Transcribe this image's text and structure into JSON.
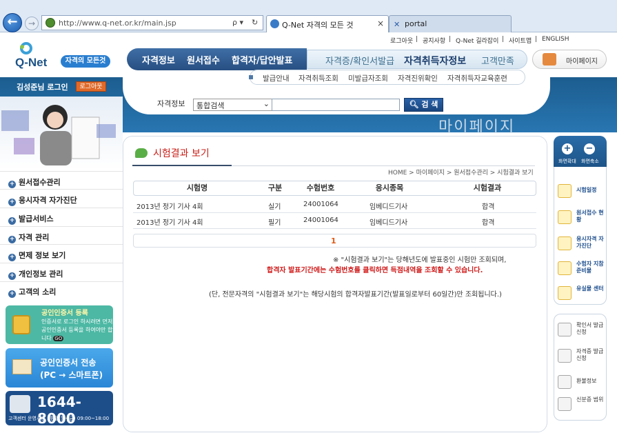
{
  "browser": {
    "url": "http://www.q-net.or.kr/main.jsp",
    "search_glyph": "ρ ▾",
    "refresh_glyph": "↻",
    "tabs": [
      {
        "label": "Q-Net 자격의 모든 것",
        "close": "×"
      },
      {
        "label": "portal"
      }
    ]
  },
  "utility_links": [
    "로그아웃",
    "|",
    "공지사항",
    "|",
    "Q-Net 길라잡이",
    "|",
    "사이트맵",
    "|",
    "ENGLISH"
  ],
  "logo": {
    "text": "Q-Net",
    "badge": "자격의 모든것"
  },
  "main_nav": {
    "left": [
      "자격정보",
      "원서접수",
      "합격자/답안발표"
    ],
    "right": [
      "자격증/확인서발급",
      "자격취득자정보",
      "고객만족"
    ],
    "mypage": "마이페이지"
  },
  "sub_nav": [
    "발급안내",
    "자격취득조회",
    "미발급자조회",
    "자격진위확인",
    "자격취득자교육훈련"
  ],
  "search": {
    "label": "자격정보",
    "select_value": "통합검색",
    "button": "검 색"
  },
  "watermark": "마이페이지",
  "user": {
    "name": "김성준님 로그인",
    "logout": "로그아웃"
  },
  "left_menu": [
    "원서접수관리",
    "응시자격 자가진단",
    "발급서비스",
    "자격 관리",
    "면제 정보 보기",
    "개인정보 관리",
    "고객의 소리"
  ],
  "promo": {
    "cert_title": "공인인증서 등록",
    "cert_desc": "인증서로 로그인 하시려면 먼저 공인인증서 등록을 하여야만 합니다",
    "go": "GO",
    "transfer_line1": "공인인증서 전송",
    "transfer_line2": "(PC → 스마트폰)",
    "phone": "1644-8000",
    "hours": "고객센터 운영시간 : 평일(월~금) 09:00~18:00"
  },
  "page": {
    "title": "시험결과 보기",
    "breadcrumb": "HOME > 마이페이지 > 원서접수관리 > 시험결과 보기"
  },
  "results": {
    "headers": [
      "시험명",
      "구분",
      "수험번호",
      "응시종목",
      "시험결과"
    ],
    "rows": [
      [
        "2013년 정기 기사 4회",
        "실기",
        "24001064",
        "임베디드기사",
        "합격"
      ],
      [
        "2013년 정기 기사 4회",
        "필기",
        "24001064",
        "임베디드기사",
        "합격"
      ]
    ],
    "page": "1"
  },
  "notes": {
    "n1": "※ \"시험결과 보기\"는 당해년도에 발표중인 시험만 조회되며,",
    "n2": "합격자 발표기간에는 수험번호를 클릭하면 득점내역을 조회할 수 있습니다.",
    "n3": "(단, 전문자격의 \"시험결과 보기\"는 해당시험의 합격자발표기간(발표일로부터 60일간)만 조회됩니다.)"
  },
  "right_sidebar": {
    "zoom_in": "화면확대",
    "zoom_out": "화면축소",
    "quick": [
      "시험일정",
      "원서접수 현황",
      "응시자격 자가진단",
      "수험자 지참준비물",
      "유실물 센터"
    ],
    "services": [
      "확인서 발급신청",
      "자격증 발급신청",
      "환불정보",
      "신분증 범위"
    ]
  }
}
